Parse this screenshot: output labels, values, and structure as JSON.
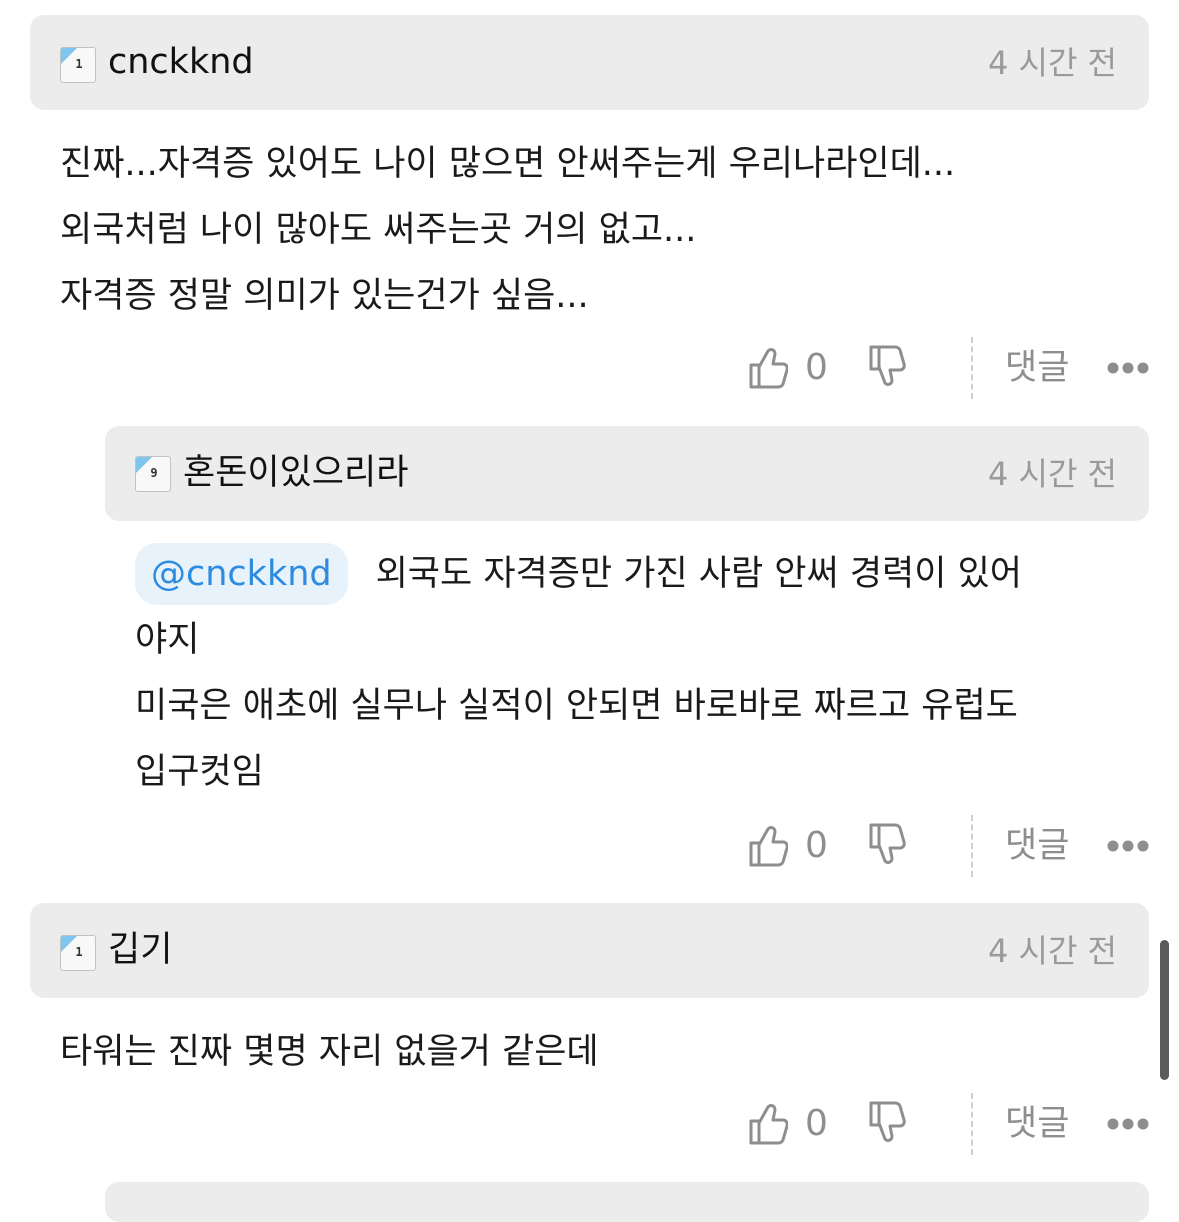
{
  "comments": [
    {
      "username": "cnckknd",
      "level": "1",
      "time": "4 시간 전",
      "lines": [
        "진짜...자격증 있어도 나이 많으면 안써주는게 우리나라인데...",
        "외국처럼 나이 많아도 써주는곳 거의 없고...",
        "자격증 정말 의미가 있는건가 싶음..."
      ],
      "like_count": "0",
      "reply_label": "댓글"
    },
    {
      "username": "혼돈이있으리라",
      "level": "9",
      "time": "4 시간 전",
      "mention": "@cnckknd",
      "lines": [
        "외국도 자격증만 가진 사람 안써 경력이 있어",
        "야지",
        "미국은 애초에 실무나 실적이 안되면 바로바로 짜르고 유럽도",
        "입구컷임"
      ],
      "like_count": "0",
      "reply_label": "댓글"
    },
    {
      "username": "깁기",
      "level": "1",
      "time": "4 시간 전",
      "lines": [
        "타워는 진짜 몇명 자리 없을거 같은데"
      ],
      "like_count": "0",
      "reply_label": "댓글"
    }
  ],
  "icons": {
    "like": "thumb-up-icon",
    "dislike": "thumb-down-icon",
    "more": "more-dots-icon",
    "level": "level-badge-icon"
  },
  "colors": {
    "header_bg": "#ececec",
    "mention_bg": "#e8f2fb",
    "mention_text": "#2d8be0",
    "level_badge": "#7ec6f0",
    "muted_text": "#8e8e8e"
  }
}
